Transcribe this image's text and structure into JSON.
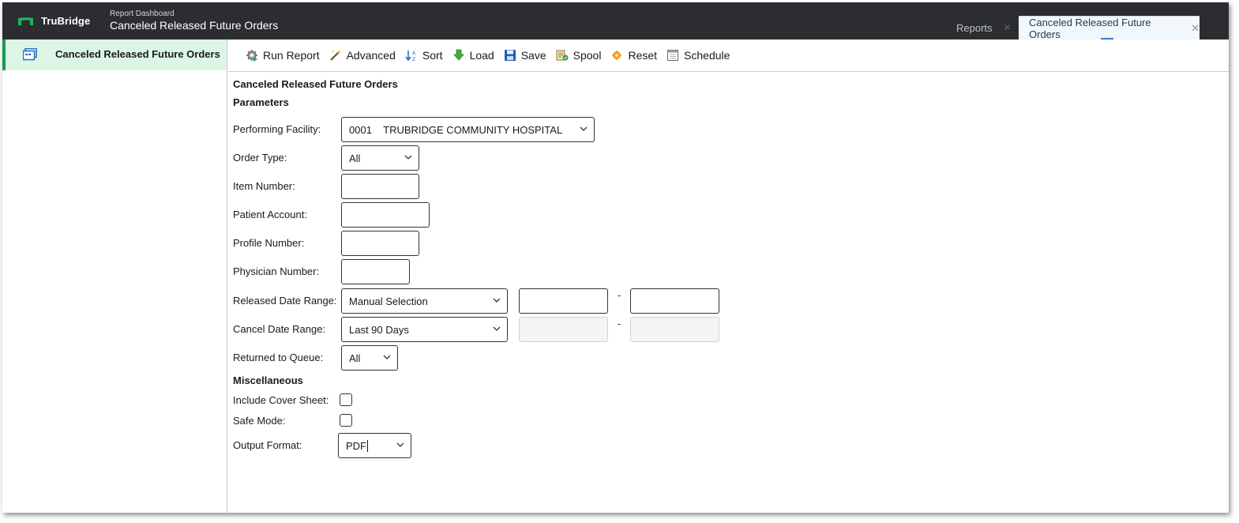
{
  "header": {
    "brand": "TruBridge",
    "breadcrumb_small": "Report Dashboard",
    "breadcrumb_title": "Canceled Released Future Orders",
    "tabs": [
      {
        "label": "Reports",
        "close": "✕"
      },
      {
        "label": "Canceled Released Future Orders",
        "close": "✕"
      }
    ]
  },
  "sidebar": {
    "items": [
      {
        "label": "Canceled Released Future Orders",
        "icon": "report-icon"
      }
    ]
  },
  "toolbar": {
    "items": [
      {
        "label": "Run Report",
        "icon": "gear-run-icon"
      },
      {
        "label": "Advanced",
        "icon": "wand-icon"
      },
      {
        "label": "Sort",
        "icon": "sort-icon"
      },
      {
        "label": "Load",
        "icon": "load-arrow-icon"
      },
      {
        "label": "Save",
        "icon": "floppy-icon"
      },
      {
        "label": "Spool",
        "icon": "spool-icon"
      },
      {
        "label": "Reset",
        "icon": "reset-icon"
      },
      {
        "label": "Schedule",
        "icon": "calendar-icon"
      }
    ]
  },
  "form": {
    "title": "Canceled Released Future Orders",
    "parameters_heading": "Parameters",
    "performing_facility": {
      "label": "Performing Facility:",
      "value": "0001    TRUBRIDGE COMMUNITY HOSPITAL"
    },
    "order_type": {
      "label": "Order Type:",
      "value": "All"
    },
    "item_number": {
      "label": "Item Number:",
      "value": ""
    },
    "patient_account": {
      "label": "Patient Account:",
      "value": ""
    },
    "profile_number": {
      "label": "Profile Number:",
      "value": ""
    },
    "physician_number": {
      "label": "Physician Number:",
      "value": ""
    },
    "released_date_range": {
      "label": "Released Date Range:",
      "value": "Manual Selection",
      "from": "",
      "to": "",
      "separator": "-"
    },
    "cancel_date_range": {
      "label": "Cancel Date Range:",
      "value": "Last 90 Days",
      "from": "",
      "to": "",
      "separator": "-"
    },
    "returned_to_queue": {
      "label": "Returned to Queue:",
      "value": "All"
    },
    "misc_heading": "Miscellaneous",
    "include_cover_sheet": {
      "label": "Include Cover Sheet:",
      "checked": false
    },
    "safe_mode": {
      "label": "Safe Mode:",
      "checked": false
    },
    "output_format": {
      "label": "Output Format:",
      "value": "PDF"
    }
  },
  "colors": {
    "header_bg": "#2b2d30",
    "sidebar_active_bg": "#ddf5e5",
    "sidebar_accent": "#1a9b4b",
    "active_tab_bg": "#f2f7fb",
    "tab_underline": "#2f7fd1"
  }
}
